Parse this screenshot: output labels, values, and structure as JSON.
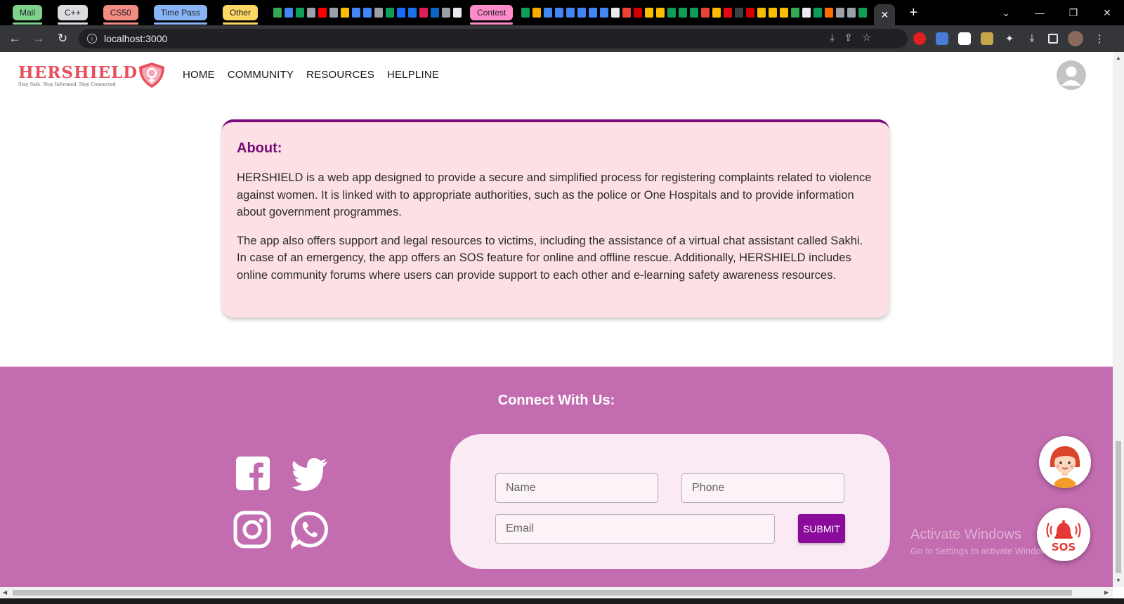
{
  "browser": {
    "tab_groups": [
      {
        "label": "Mail",
        "color": "#7fd28d"
      },
      {
        "label": "C++",
        "color": "#dadce0"
      },
      {
        "label": "CS50",
        "color": "#f28b82"
      },
      {
        "label": "Time Pass",
        "color": "#8ab4f8"
      },
      {
        "label": "Other",
        "color": "#fdd663"
      },
      {
        "label": "Contest",
        "color": "#ff8bcb"
      }
    ],
    "url": "localhost:3000"
  },
  "site": {
    "logo_text": "HERSHIELD",
    "tagline": "Stay Safe, Stay Informed, Stay Connected",
    "nav": [
      "HOME",
      "COMMUNITY",
      "RESOURCES",
      "HELPLINE"
    ]
  },
  "about": {
    "title": "About:",
    "paragraphs": [
      "HERSHIELD is a web app designed to provide a secure and simplified process for registering complaints related to violence against women. It is linked with to appropriate authorities, such as the police or One Hospitals and to provide information about government programmes.",
      "The app also offers support and legal resources to victims, including the assistance of a virtual chat assistant called Sakhi. In case of an emergency, the app offers an SOS feature for online and offline rescue. Additionally, HERSHIELD includes online community forums where users can provide support to each other and e-learning safety awareness resources."
    ]
  },
  "footer": {
    "title": "Connect With Us:",
    "form": {
      "name_placeholder": "Name",
      "phone_placeholder": "Phone",
      "email_placeholder": "Email",
      "submit_label": "SUBMIT"
    },
    "sos_label": "SOS",
    "social_icons": [
      "facebook-icon",
      "twitter-icon",
      "instagram-icon",
      "whatsapp-icon"
    ]
  },
  "watermark": {
    "line1": "Activate Windows",
    "line2": "Go to Settings to activate Windows."
  },
  "colors": {
    "footer_bg": "#c46cb0",
    "accent_purple": "#7a0a7a",
    "submit_bg": "#8a0b9a",
    "about_bg": "#fde0e6",
    "logo_red": "#e8505b"
  }
}
